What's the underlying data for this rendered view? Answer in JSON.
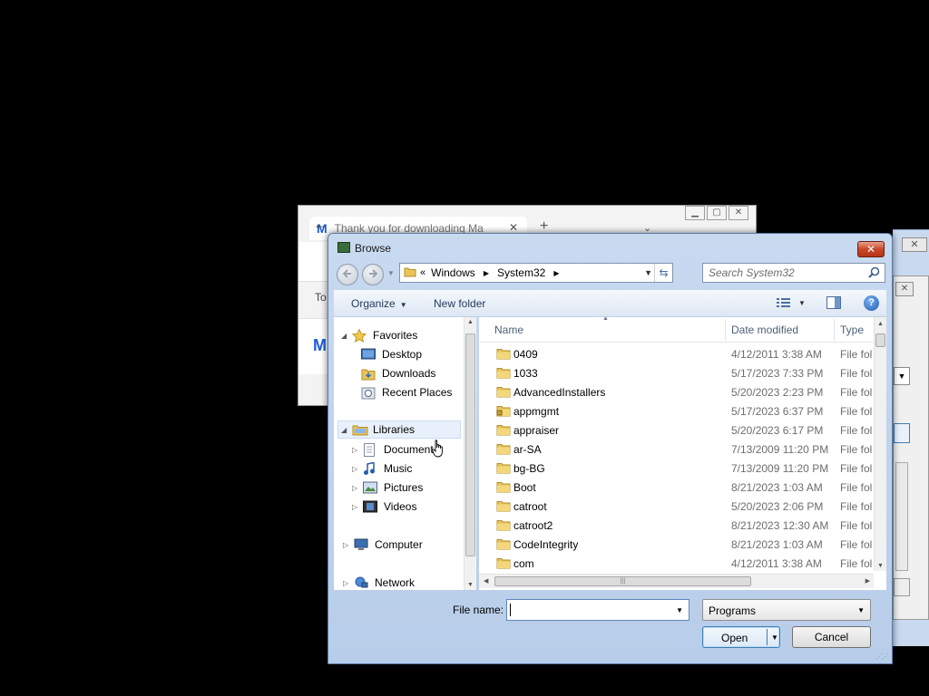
{
  "background_browser": {
    "tab_title": "Thank you for downloading Ma",
    "toolbar_text": "To"
  },
  "dialog": {
    "title": "Browse",
    "close_glyph": "✕"
  },
  "address": {
    "chevrons": "«",
    "breadcrumbs": [
      "Windows",
      "System32"
    ]
  },
  "search": {
    "placeholder": "Search System32"
  },
  "commands": {
    "organize": "Organize",
    "new_folder": "New folder",
    "help": "?"
  },
  "nav_tree": {
    "favorites": {
      "label": "Favorites",
      "items": [
        "Desktop",
        "Downloads",
        "Recent Places"
      ]
    },
    "libraries": {
      "label": "Libraries",
      "items": [
        "Document",
        "Music",
        "Pictures",
        "Videos"
      ]
    },
    "computer": "Computer",
    "network": "Network"
  },
  "columns": {
    "name": "Name",
    "date_modified": "Date modified",
    "type": "Type"
  },
  "files": [
    {
      "name": "0409",
      "date": "4/12/2011 3:38 AM",
      "type": "File fol",
      "locked": false
    },
    {
      "name": "1033",
      "date": "5/17/2023 7:33 PM",
      "type": "File fol",
      "locked": false
    },
    {
      "name": "AdvancedInstallers",
      "date": "5/20/2023 2:23 PM",
      "type": "File fol",
      "locked": false
    },
    {
      "name": "appmgmt",
      "date": "5/17/2023 6:37 PM",
      "type": "File fol",
      "locked": true
    },
    {
      "name": "appraiser",
      "date": "5/20/2023 6:17 PM",
      "type": "File fol",
      "locked": false
    },
    {
      "name": "ar-SA",
      "date": "7/13/2009 11:20 PM",
      "type": "File fol",
      "locked": false
    },
    {
      "name": "bg-BG",
      "date": "7/13/2009 11:20 PM",
      "type": "File fol",
      "locked": false
    },
    {
      "name": "Boot",
      "date": "8/21/2023 1:03 AM",
      "type": "File fol",
      "locked": false
    },
    {
      "name": "catroot",
      "date": "5/20/2023 2:06 PM",
      "type": "File fol",
      "locked": false
    },
    {
      "name": "catroot2",
      "date": "8/21/2023 12:30 AM",
      "type": "File fol",
      "locked": false
    },
    {
      "name": "CodeIntegrity",
      "date": "8/21/2023 1:03 AM",
      "type": "File fol",
      "locked": false
    },
    {
      "name": "com",
      "date": "4/12/2011 3:38 AM",
      "type": "File fol",
      "locked": false
    }
  ],
  "bottom": {
    "file_name_label": "File name:",
    "file_name_value": "",
    "file_type": "Programs",
    "open": "Open",
    "cancel": "Cancel"
  },
  "colors": {
    "title_gradient_top": "#c8daf0",
    "close_red": "#c7482b",
    "folder_yellow": "#e8c45a",
    "accent_blue": "#3c7fb1"
  },
  "icons": {
    "back": "back-arrow-icon",
    "forward": "forward-arrow-icon",
    "refresh": "refresh-icon",
    "search": "search-icon",
    "folder": "folder-icon",
    "help": "help-icon"
  }
}
